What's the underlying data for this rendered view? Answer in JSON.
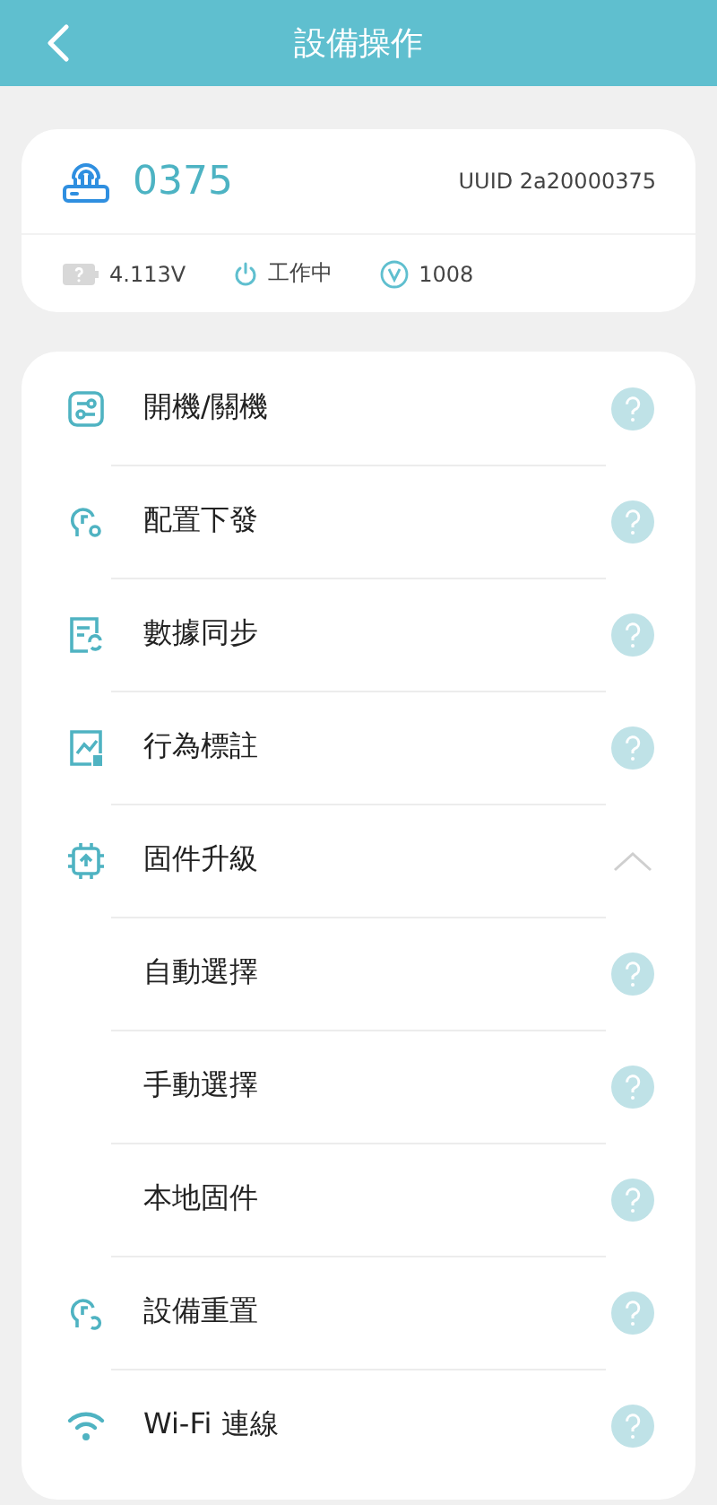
{
  "header": {
    "title": "設備操作"
  },
  "device": {
    "name": "0375",
    "uuid": "UUID 2a20000375",
    "voltage": "4.113V",
    "status": "工作中",
    "version": "1008"
  },
  "menu": [
    {
      "kind": "action",
      "label": "開機/關機"
    },
    {
      "kind": "action",
      "label": "配置下發"
    },
    {
      "kind": "action",
      "label": "數據同步"
    },
    {
      "kind": "action",
      "label": "行為標註"
    },
    {
      "kind": "group",
      "label": "固件升級",
      "expanded": true,
      "children": [
        {
          "label": "自動選擇"
        },
        {
          "label": "手動選擇"
        },
        {
          "label": "本地固件"
        }
      ]
    },
    {
      "kind": "action",
      "label": "設備重置"
    },
    {
      "kind": "action",
      "label": "Wi-Fi 連線"
    }
  ]
}
